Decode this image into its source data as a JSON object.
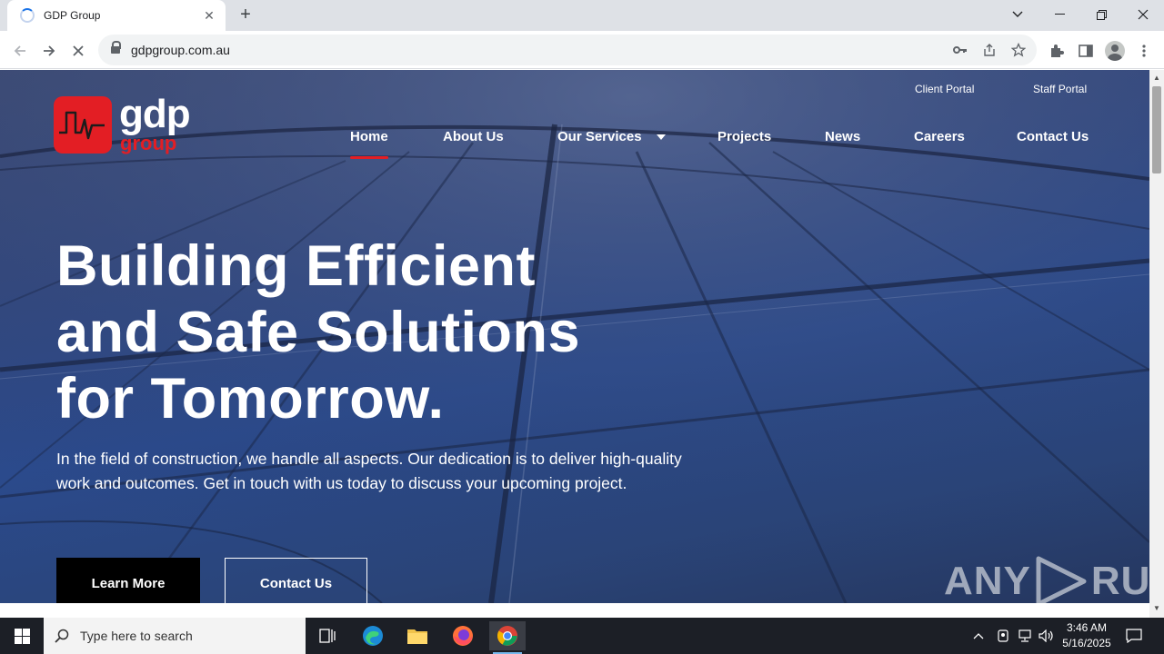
{
  "browser": {
    "tab_title": "GDP Group",
    "url": "gdpgroup.com.au",
    "new_tab_glyph": "+",
    "tab_close_glyph": "✕"
  },
  "site": {
    "logo_text": "gdp",
    "logo_subtext": "group",
    "utility_links": [
      "Client Portal",
      "Staff Portal"
    ],
    "nav": [
      {
        "label": "Home",
        "active": true
      },
      {
        "label": "About Us"
      },
      {
        "label": "Our Services",
        "dropdown": true
      },
      {
        "label": "Projects"
      },
      {
        "label": "News"
      },
      {
        "label": "Careers"
      },
      {
        "label": "Contact Us"
      }
    ],
    "hero": {
      "title_lines": [
        "Building Efficient",
        "and Safe Solutions",
        "for Tomorrow."
      ],
      "text": "In the field of construction, we handle all aspects. Our dedication is to deliver high-quality work and outcomes. Get in touch with us today to discuss your upcoming project.",
      "primary_button": "Learn More",
      "secondary_button": "Contact Us"
    },
    "watermark": {
      "left": "ANY",
      "right": "RUN"
    }
  },
  "taskbar": {
    "search_placeholder": "Type here to search",
    "time": "3:46 AM",
    "date": "5/16/2025"
  },
  "colors": {
    "brand_red": "#e31e24",
    "hero_blue": "#2b4a8c",
    "taskbar": "#1c1f26"
  }
}
